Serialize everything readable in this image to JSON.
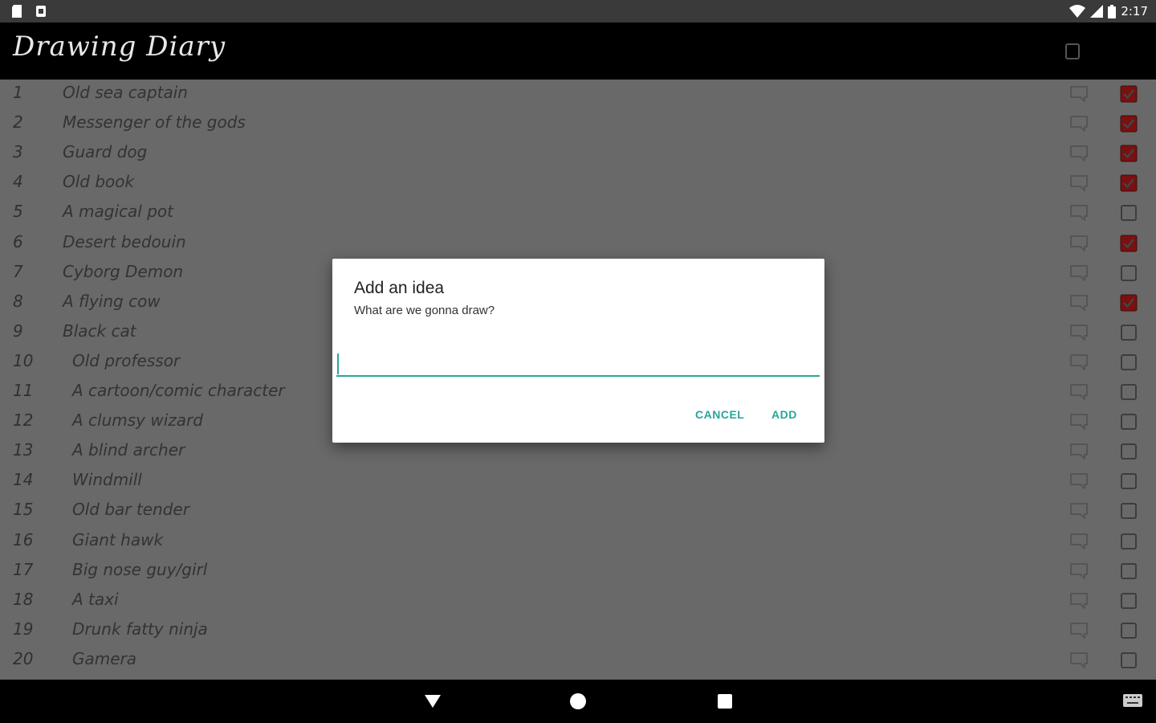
{
  "status_bar": {
    "time": "2:17",
    "icons": [
      "sd-card-icon",
      "notification-icon",
      "wifi-icon",
      "signal-icon",
      "battery-icon"
    ]
  },
  "app_bar": {
    "title": "Drawing Diary",
    "menu_icon": "menu-icon"
  },
  "ideas": [
    {
      "num": "1",
      "text": "Old sea captain",
      "done": true
    },
    {
      "num": "2",
      "text": "Messenger of the gods",
      "done": true
    },
    {
      "num": "3",
      "text": "Guard dog",
      "done": true
    },
    {
      "num": "4",
      "text": "Old book",
      "done": true
    },
    {
      "num": "5",
      "text": "A magical pot",
      "done": false
    },
    {
      "num": "6",
      "text": "Desert bedouin",
      "done": true
    },
    {
      "num": "7",
      "text": "Cyborg Demon",
      "done": false
    },
    {
      "num": "8",
      "text": "A flying cow",
      "done": true
    },
    {
      "num": "9",
      "text": "Black cat",
      "done": false
    },
    {
      "num": "10",
      "text": "Old professor",
      "done": false
    },
    {
      "num": "11",
      "text": "A cartoon/comic character",
      "done": false
    },
    {
      "num": "12",
      "text": "A clumsy wizard",
      "done": false
    },
    {
      "num": "13",
      "text": "A blind archer",
      "done": false
    },
    {
      "num": "14",
      "text": "Windmill",
      "done": false
    },
    {
      "num": "15",
      "text": "Old bar tender",
      "done": false
    },
    {
      "num": "16",
      "text": "Giant hawk",
      "done": false
    },
    {
      "num": "17",
      "text": "Big nose guy/girl",
      "done": false
    },
    {
      "num": "18",
      "text": "A taxi",
      "done": false
    },
    {
      "num": "19",
      "text": "Drunk fatty ninja",
      "done": false
    },
    {
      "num": "20",
      "text": "Gamera",
      "done": false
    }
  ],
  "dialog": {
    "title": "Add an idea",
    "message": "What are we gonna draw?",
    "input_value": "",
    "cancel_label": "CANCEL",
    "add_label": "ADD"
  },
  "nav_bar": {
    "icons": [
      "back-icon",
      "home-icon",
      "recents-icon",
      "keyboard-icon"
    ]
  },
  "colors": {
    "accent": "#26a69a",
    "checked": "#7a1010",
    "list_bg": "#696969",
    "bar_bg": "#000000"
  }
}
